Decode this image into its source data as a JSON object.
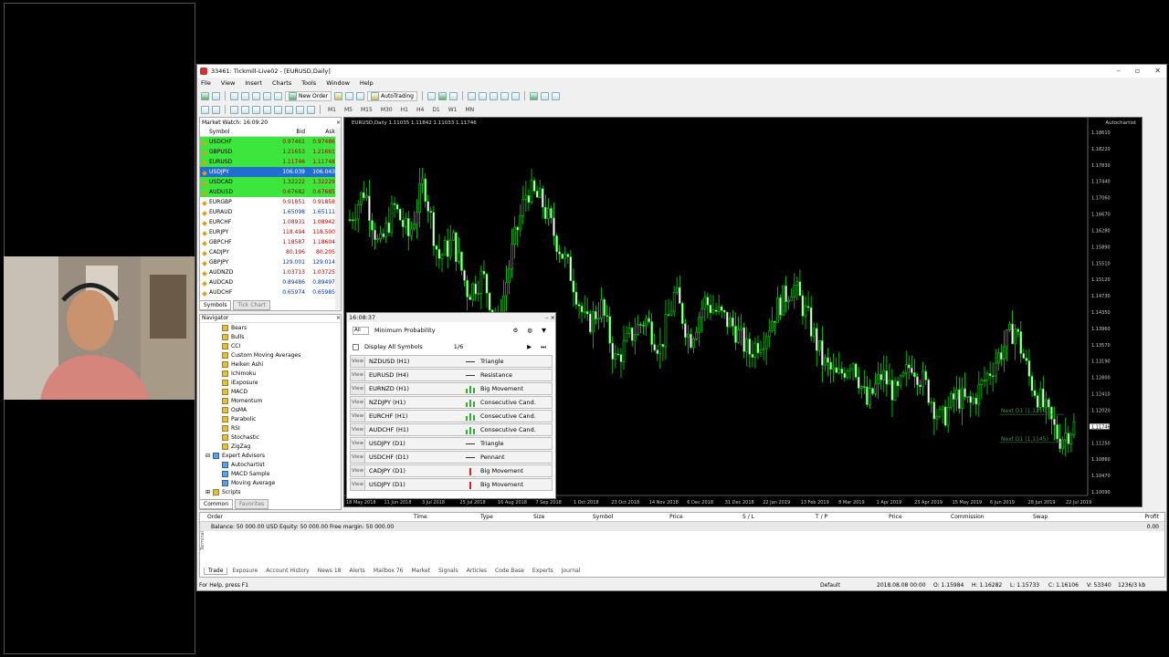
{
  "window": {
    "title": "33461: Tickmill-Live02 - [EURUSD,Daily]"
  },
  "menu": [
    "File",
    "View",
    "Insert",
    "Charts",
    "Tools",
    "Window",
    "Help"
  ],
  "toolbar": {
    "new_order": "New Order",
    "autotrading": "AutoTrading",
    "timeframes": [
      "M1",
      "M5",
      "M15",
      "M30",
      "H1",
      "H4",
      "D1",
      "W1",
      "MN"
    ]
  },
  "market_watch": {
    "title": "Market Watch: 16:09:20",
    "columns": {
      "symbol": "Symbol",
      "bid": "Bid",
      "ask": "Ask"
    },
    "rows": [
      {
        "symbol": "USDCHF",
        "bid": "0.97461",
        "ask": "0.97486"
      },
      {
        "symbol": "GBPUSD",
        "bid": "1.21653",
        "ask": "1.21661"
      },
      {
        "symbol": "EURUSD",
        "bid": "1.11746",
        "ask": "1.11748"
      },
      {
        "symbol": "USDJPY",
        "bid": "106.039",
        "ask": "106.043"
      },
      {
        "symbol": "USDCAD",
        "bid": "1.32222",
        "ask": "1.32229"
      },
      {
        "symbol": "AUDUSD",
        "bid": "0.67682",
        "ask": "0.67685"
      },
      {
        "symbol": "EURGBP",
        "bid": "0.91851",
        "ask": "0.91858"
      },
      {
        "symbol": "EURAUD",
        "bid": "1.65098",
        "ask": "1.65111"
      },
      {
        "symbol": "EURCHF",
        "bid": "1.08931",
        "ask": "1.08942"
      },
      {
        "symbol": "EURJPY",
        "bid": "118.494",
        "ask": "118.500"
      },
      {
        "symbol": "GBPCHF",
        "bid": "1.18587",
        "ask": "1.18604"
      },
      {
        "symbol": "CADJPY",
        "bid": "80.196",
        "ask": "80.205"
      },
      {
        "symbol": "GBPJPY",
        "bid": "129.001",
        "ask": "129.014"
      },
      {
        "symbol": "AUDNZD",
        "bid": "1.03713",
        "ask": "1.03725"
      },
      {
        "symbol": "AUDCAD",
        "bid": "0.89486",
        "ask": "0.89497"
      },
      {
        "symbol": "AUDCHF",
        "bid": "0.65974",
        "ask": "0.65985"
      }
    ],
    "tabs": [
      "Symbols",
      "Tick Chart"
    ]
  },
  "navigator": {
    "title": "Navigator",
    "indicators": [
      "Bears",
      "Bulls",
      "CCI",
      "Custom Moving Averages",
      "Heiken Ashi",
      "Ichimoku",
      "iExposure",
      "MACD",
      "Momentum",
      "OsMA",
      "Parabolic",
      "RSI",
      "Stochastic",
      "ZigZag"
    ],
    "expert_advisors": "Expert Advisors",
    "experts": [
      "Autochartist",
      "MACD Sample",
      "Moving Average"
    ],
    "scripts": "Scripts",
    "tabs": [
      "Common",
      "Favorites"
    ]
  },
  "chart": {
    "title": "EURUSD,Daily  1.11035 1.11842 1.11033 1.11746",
    "autochartist_label": "Autochartist",
    "price_labels": [
      "1.18610",
      "1.18220",
      "1.17830",
      "1.17440",
      "1.17060",
      "1.16670",
      "1.16280",
      "1.15890",
      "1.15510",
      "1.15120",
      "1.14730",
      "1.14350",
      "1.13960",
      "1.13570",
      "1.13190",
      "1.12800",
      "1.12410",
      "1.12020",
      "1.11746",
      "1.11250",
      "1.10860",
      "1.10470",
      "1.10090"
    ],
    "date_labels": [
      "18 May 2018",
      "11 Jun 2018",
      "3 Jul 2018",
      "25 Jul 2018",
      "16 Aug 2018",
      "7 Sep 2018",
      "1 Oct 2018",
      "23 Oct 2018",
      "14 Nov 2018",
      "6 Dec 2018",
      "31 Dec 2018",
      "22 Jan 2019",
      "13 Feb 2019",
      "8 Mar 2019",
      "1 Apr 2019",
      "23 Apr 2019",
      "15 May 2019",
      "6 Jun 2019",
      "28 Jun 2019",
      "22 Jul 2019"
    ],
    "annotations": [
      "Next D1 (1.1210)",
      "Next D1 (1.1145)"
    ]
  },
  "chart_data": {
    "type": "candlestick",
    "title": "EURUSD,Daily",
    "ylim": [
      1.1009,
      1.1861
    ],
    "approx_closes": [
      1.165,
      1.172,
      1.158,
      1.168,
      1.161,
      1.174,
      1.156,
      1.16,
      1.148,
      1.152,
      1.14,
      1.158,
      1.172,
      1.169,
      1.16,
      1.152,
      1.14,
      1.145,
      1.132,
      1.138,
      1.142,
      1.135,
      1.148,
      1.137,
      1.146,
      1.143,
      1.14,
      1.134,
      1.138,
      1.145,
      1.15,
      1.142,
      1.132,
      1.128,
      1.133,
      1.122,
      1.129,
      1.124,
      1.132,
      1.126,
      1.118,
      1.124,
      1.122,
      1.128,
      1.134,
      1.14,
      1.128,
      1.121,
      1.114,
      1.117
    ]
  },
  "autochartist": {
    "time": "16:08:37",
    "filter_label": "All",
    "min_prob": "Minimum Probability",
    "display_all": "Display All Symbols",
    "page": "1/6",
    "view": "View",
    "results": [
      {
        "pair": "NZDUSD (H1)",
        "pattern": "Triangle",
        "icon": "tri"
      },
      {
        "pair": "EURUSD (H4)",
        "pattern": "Resistance",
        "icon": "tri"
      },
      {
        "pair": "EURNZD (H1)",
        "pattern": "Big Movement",
        "icon": "bars"
      },
      {
        "pair": "NZDJPY (H1)",
        "pattern": "Consecutive Cand.",
        "icon": "bars"
      },
      {
        "pair": "EURCHF (H1)",
        "pattern": "Consecutive Cand.",
        "icon": "bars"
      },
      {
        "pair": "AUDCHF (H1)",
        "pattern": "Consecutive Cand.",
        "icon": "bars"
      },
      {
        "pair": "USDJPY (D1)",
        "pattern": "Triangle",
        "icon": "tri"
      },
      {
        "pair": "USDCHF (D1)",
        "pattern": "Pennant",
        "icon": "tri"
      },
      {
        "pair": "CADJPY (D1)",
        "pattern": "Big Movement",
        "icon": "red"
      },
      {
        "pair": "USDJPY (D1)",
        "pattern": "Big Movement",
        "icon": "red"
      }
    ]
  },
  "terminal": {
    "columns": [
      "Order",
      "Time",
      "Type",
      "Size",
      "Symbol",
      "Price",
      "S / L",
      "T / P",
      "Price",
      "Commission",
      "Swap",
      "Profit"
    ],
    "balance": "Balance: 50 000.00 USD  Equity: 50 000.00  Free margin: 50 000.00",
    "balance_profit": "0.00",
    "tabs": [
      "Trade",
      "Exposure",
      "Account History",
      "News 18",
      "Alerts",
      "Mailbox 76",
      "Market",
      "Signals",
      "Articles",
      "Code Base",
      "Experts",
      "Journal"
    ],
    "vertical_label": "Terminal"
  },
  "statusbar": {
    "help": "For Help, press F1",
    "profile": "Default",
    "time": "2018.08.08 00:00",
    "open": "O: 1.15984",
    "high": "H: 1.16282",
    "low": "L: 1.15733",
    "close": "C: 1.16106",
    "volume": "V: 53340",
    "traffic": "1236/3 kb"
  }
}
